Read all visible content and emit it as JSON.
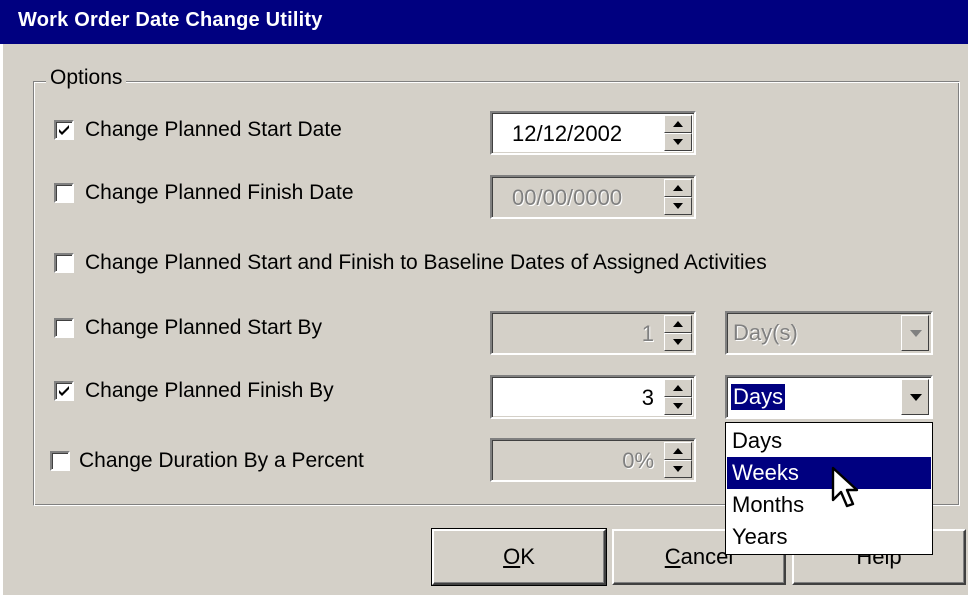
{
  "window": {
    "title": "Work Order Date Change Utility"
  },
  "options": {
    "legend": "Options",
    "rows": [
      {
        "label": "Change Planned Start Date",
        "checked": true,
        "field_value": "12/12/2002",
        "field_enabled": true
      },
      {
        "label": "Change Planned Finish Date",
        "checked": false,
        "field_value": "00/00/0000",
        "field_enabled": false
      },
      {
        "label": "Change Planned Start and Finish to Baseline Dates of Assigned Activities",
        "checked": false
      },
      {
        "label": "Change Planned Start By",
        "checked": false,
        "field_value": "1",
        "field_enabled": false,
        "unit_value": "Day(s)",
        "unit_enabled": false
      },
      {
        "label": "Change Planned Finish By",
        "checked": true,
        "field_value": "3",
        "field_enabled": true,
        "unit_value": "Days",
        "unit_enabled": true
      },
      {
        "label": "Change Duration By a Percent",
        "checked": false,
        "field_value": "0%",
        "field_enabled": false
      }
    ]
  },
  "unit_dropdown": {
    "options": [
      "Days",
      "Weeks",
      "Months",
      "Years"
    ],
    "highlighted": "Weeks"
  },
  "buttons": {
    "ok": {
      "label": "OK",
      "mnemonic": "O",
      "rest": "K"
    },
    "cancel": {
      "label": "Cancel",
      "mnemonic": "C",
      "rest": "ancel"
    },
    "help": {
      "label": "Help"
    }
  },
  "colors": {
    "titlebar": "#000080",
    "face": "#d4d0c8",
    "highlight": "#000080"
  }
}
